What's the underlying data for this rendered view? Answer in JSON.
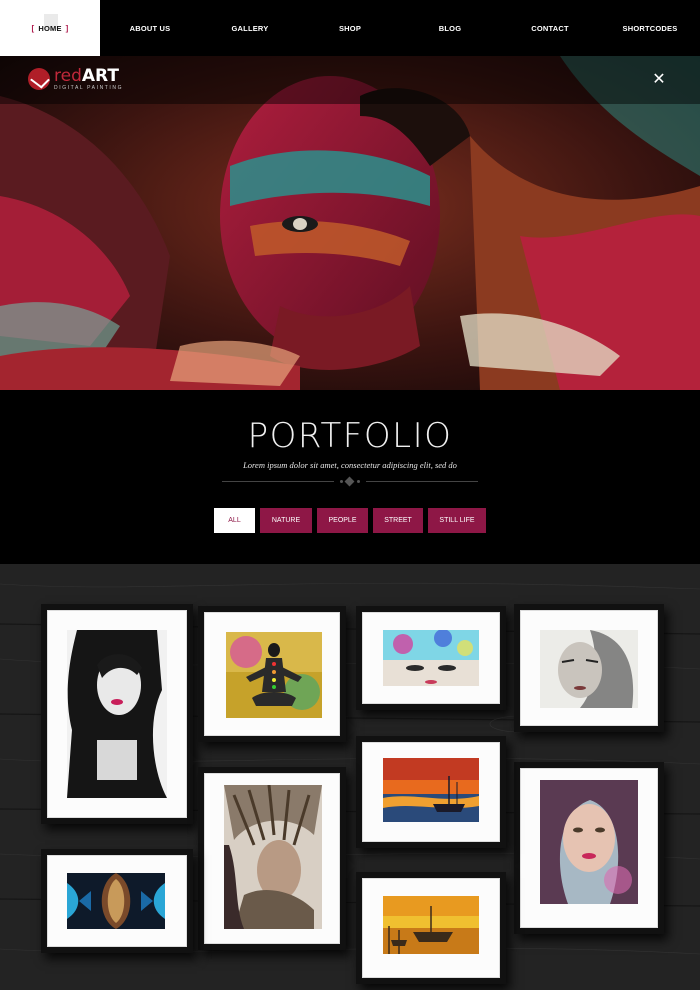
{
  "nav": {
    "home_label": "HOME",
    "items": [
      "ABOUT US",
      "GALLERY",
      "SHOP",
      "BLOG",
      "CONTACT",
      "SHORTCODES"
    ]
  },
  "logo": {
    "red": "red",
    "art": "ART",
    "tagline": "DIGITAL PAINTING"
  },
  "hero": {
    "close_icon": "close-icon",
    "image": "face-paint-portrait"
  },
  "portfolio": {
    "title": "PORTFOLIO",
    "subtitle": "Lorem ipsum dolor sit amet, consectetur adipiscing elit, sed do",
    "filters": [
      "ALL",
      "NATURE",
      "PEOPLE",
      "STREET",
      "STILL LIFE"
    ],
    "active_filter": "ALL"
  },
  "colors": {
    "accent": "#8e1746",
    "background": "#000000",
    "nav_active_bg": "#ffffff"
  },
  "gallery": {
    "items": [
      "woman-portrait-bw-pink-lips",
      "meditation-chakra-figure",
      "woman-eyes-flowers",
      "woman-face-sketch",
      "woman-portrait-pink",
      "sailboat-sunset",
      "native-headdress-portrait",
      "boats-yellow-sunset",
      "abstract-symmetric-pattern"
    ]
  }
}
